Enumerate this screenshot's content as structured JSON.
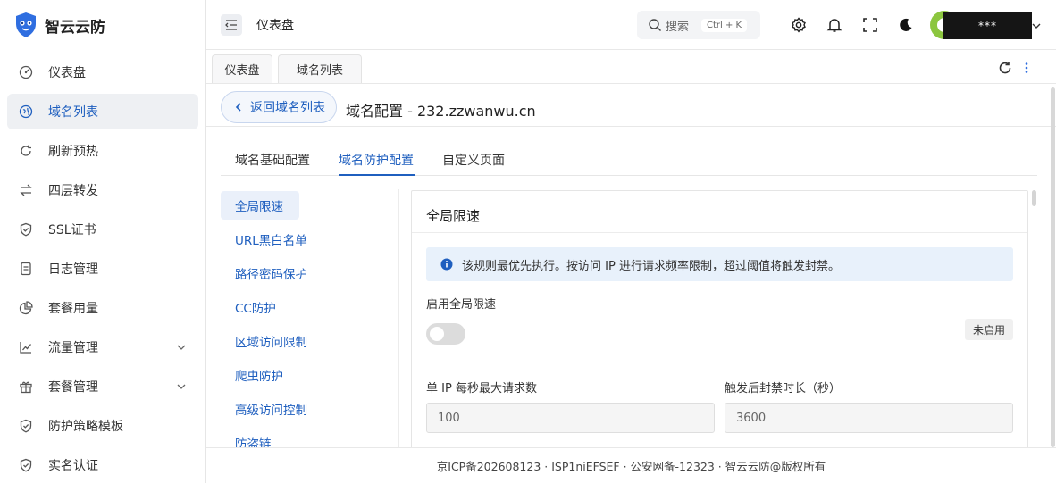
{
  "brand": {
    "name": "智云云防",
    "logo_icon": "shield-logo-icon",
    "accent": "#2f6ee0"
  },
  "sidebar": {
    "items": [
      {
        "label": "仪表盘",
        "icon": "dashboard-icon",
        "active": false
      },
      {
        "label": "域名列表",
        "icon": "globe-icon",
        "active": true
      },
      {
        "label": "刷新预热",
        "icon": "refresh-icon",
        "active": false
      },
      {
        "label": "四层转发",
        "icon": "transfer-icon",
        "active": false
      },
      {
        "label": "SSL证书",
        "icon": "shield-check-icon",
        "active": false
      },
      {
        "label": "日志管理",
        "icon": "document-icon",
        "active": false
      },
      {
        "label": "套餐用量",
        "icon": "pie-chart-icon",
        "active": false
      },
      {
        "label": "流量管理",
        "icon": "line-chart-icon",
        "active": false,
        "expandable": true
      },
      {
        "label": "套餐管理",
        "icon": "gift-icon",
        "active": false,
        "expandable": true
      },
      {
        "label": "防护策略模板",
        "icon": "shield-check-icon",
        "active": false
      },
      {
        "label": "实名认证",
        "icon": "shield-check-icon",
        "active": false
      }
    ]
  },
  "header": {
    "title": "仪表盘",
    "search": {
      "label": "搜索",
      "shortcut": "Ctrl + K"
    },
    "user": {
      "name": "***"
    }
  },
  "page_tabs": [
    {
      "label": "仪表盘"
    },
    {
      "label": "域名列表"
    }
  ],
  "main": {
    "back_label": "返回域名列表",
    "title": "域名配置 - 232.zzwanwu.cn",
    "tabs": [
      {
        "label": "域名基础配置",
        "active": false
      },
      {
        "label": "域名防护配置",
        "active": true
      },
      {
        "label": "自定义页面",
        "active": false
      }
    ],
    "subnav": [
      {
        "label": "全局限速",
        "active": true
      },
      {
        "label": "URL黑白名单",
        "active": false
      },
      {
        "label": "路径密码保护",
        "active": false
      },
      {
        "label": "CC防护",
        "active": false
      },
      {
        "label": "区域访问限制",
        "active": false
      },
      {
        "label": "爬虫防护",
        "active": false
      },
      {
        "label": "高级访问控制",
        "active": false
      },
      {
        "label": "防盗链",
        "active": false
      }
    ],
    "panel": {
      "title": "全局限速",
      "alert": "该规则最优先执行。按访问 IP 进行请求频率限制，超过阈值将触发封禁。",
      "enable_label": "启用全局限速",
      "enabled": false,
      "status_badge": "未启用",
      "fields": [
        {
          "label": "单 IP 每秒最大请求数",
          "value": "100"
        },
        {
          "label": "触发后封禁时长（秒）",
          "value": "3600"
        }
      ]
    }
  },
  "footer": {
    "text": "京ICP备202608123 · ISP1niEFSEF · 公安网备-12323 · 智云云防@版权所有"
  }
}
